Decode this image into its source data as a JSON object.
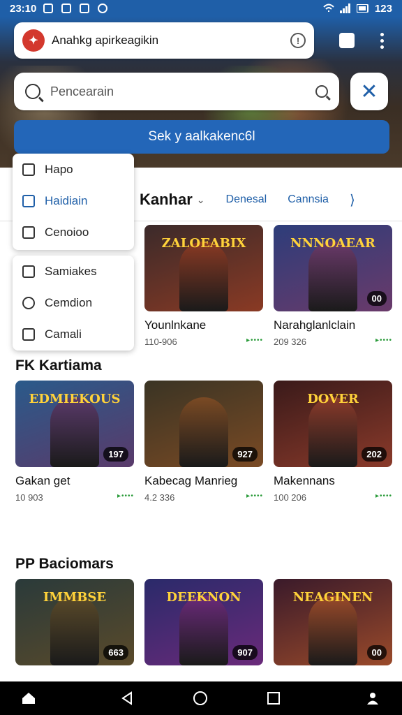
{
  "status": {
    "time": "23:10",
    "battery": "123"
  },
  "address": {
    "text": "Anahkg apirkeagikin"
  },
  "search": {
    "placeholder": "Pencearain"
  },
  "primary_button": {
    "label": "Sek y aalkakenc6l"
  },
  "tabs": {
    "main": "Kanhar",
    "items": [
      "Denesal",
      "Cannsia"
    ]
  },
  "dropdown": {
    "group1": [
      {
        "label": "Hapo",
        "icon": "checkbox-icon"
      },
      {
        "label": "Haidiain",
        "icon": "bag-icon"
      },
      {
        "label": "Cenoioo",
        "icon": "calendar-icon"
      }
    ],
    "group2": [
      {
        "label": "Samiakes",
        "icon": "briefcase-icon"
      },
      {
        "label": "Cemdion",
        "icon": "refresh-icon"
      },
      {
        "label": "Camali",
        "icon": "image-icon"
      }
    ]
  },
  "row1": [
    {
      "title": "Younlnkane",
      "meta": "110-906",
      "banner": "ZALOEABIX",
      "badge": "",
      "colors": [
        "#3b2a2a",
        "#8a3a24"
      ]
    },
    {
      "title": "Narahglanlclain",
      "meta": "209 326",
      "banner": "NNNOAEAR",
      "badge": "00",
      "colors": [
        "#2d3d7a",
        "#6a3a6a"
      ]
    }
  ],
  "sections": [
    {
      "title": "FK Kartiama",
      "cards": [
        {
          "title": "Gakan get",
          "meta": "10 903",
          "banner": "EDMIEKOUS",
          "badge": "197",
          "colors": [
            "#2a5a8a",
            "#5a3a6a"
          ]
        },
        {
          "title": "Kabecag Manrieg",
          "meta": "4.2 336",
          "banner": "",
          "badge": "927",
          "colors": [
            "#3a3424",
            "#7a4a24"
          ]
        },
        {
          "title": "Makennans",
          "meta": "100 206",
          "banner": "DOVER",
          "badge": "202",
          "colors": [
            "#3a1a1a",
            "#8a3a2a"
          ]
        }
      ]
    },
    {
      "title": "PP Baciomars",
      "cards": [
        {
          "title": "",
          "meta": "",
          "banner": "IMMBSE",
          "badge": "663",
          "colors": [
            "#2a3a3a",
            "#5a4a2a"
          ]
        },
        {
          "title": "",
          "meta": "",
          "banner": "DEEKNON",
          "badge": "907",
          "colors": [
            "#2a2a6a",
            "#6a2a7a"
          ]
        },
        {
          "title": "",
          "meta": "",
          "banner": "NEAGINEN",
          "badge": "00",
          "colors": [
            "#3a1a2a",
            "#9a4a2a"
          ]
        }
      ]
    }
  ]
}
